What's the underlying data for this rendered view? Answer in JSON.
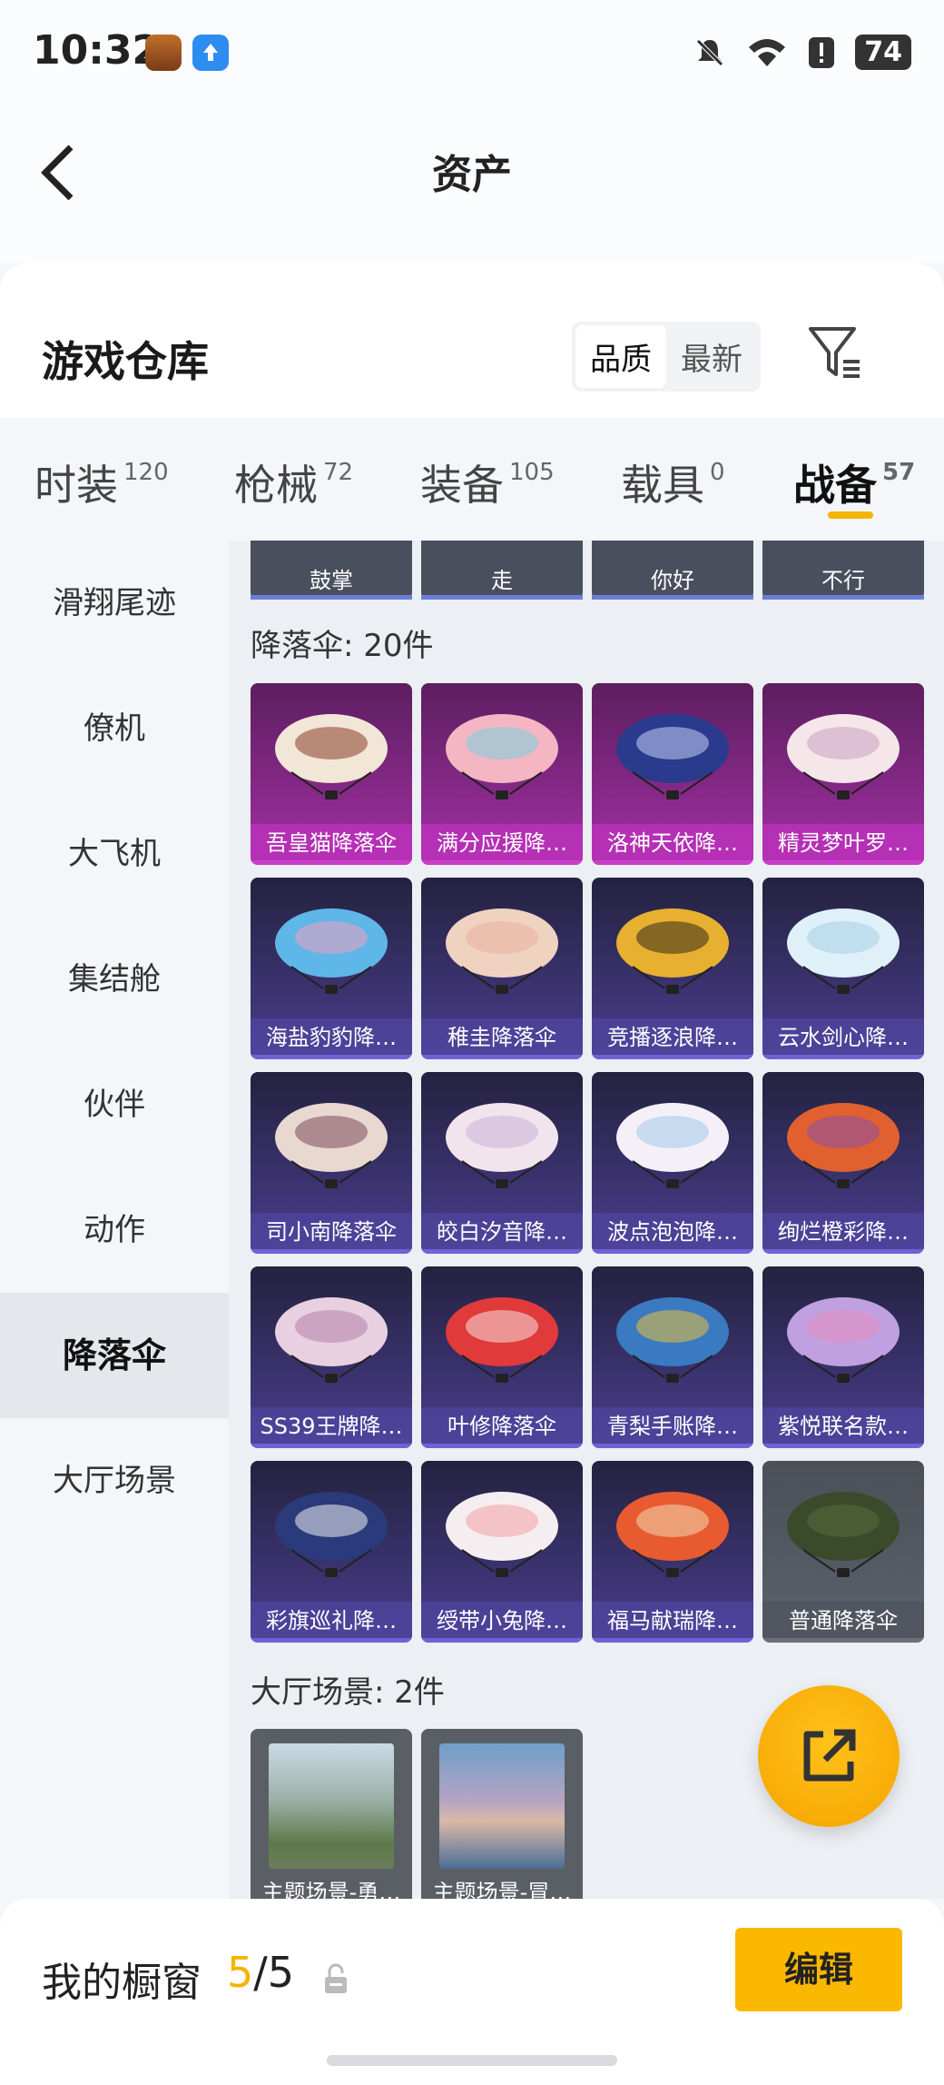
{
  "status_bar": {
    "time": "10:32",
    "battery": "74"
  },
  "nav": {
    "title": "资产"
  },
  "header": {
    "title": "游戏仓库",
    "sort_options": [
      "品质",
      "最新"
    ]
  },
  "tabs": [
    {
      "label": "时装",
      "count": "120"
    },
    {
      "label": "枪械",
      "count": "72"
    },
    {
      "label": "装备",
      "count": "105"
    },
    {
      "label": "载具",
      "count": "0"
    },
    {
      "label": "战备",
      "count": "57"
    }
  ],
  "sidebar": [
    "滑翔尾迹",
    "僚机",
    "大飞机",
    "集结舱",
    "伙伴",
    "动作",
    "降落伞",
    "大厅场景"
  ],
  "actions_row": [
    "鼓掌",
    "走",
    "你好",
    "不行"
  ],
  "parachute_section": {
    "title": "降落伞: 20件"
  },
  "parachutes": [
    "吾皇猫降落伞",
    "满分应援降…",
    "洛神天依降…",
    "精灵梦叶罗…",
    "海盐豹豹降…",
    "稚圭降落伞",
    "竞播逐浪降…",
    "云水剑心降…",
    "司小南降落伞",
    "皎白汐音降…",
    "波点泡泡降…",
    "绚烂橙彩降…",
    "SS39王牌降…",
    "叶修降落伞",
    "青梨手账降…",
    "紫悦联名款…",
    "彩旗巡礼降…",
    "绶带小兔降…",
    "福马献瑞降…",
    "普通降落伞"
  ],
  "lobby_section": {
    "title": "大厅场景: 2件"
  },
  "lobby_scenes": [
    "主题场景-勇…",
    "主题场景-冒…"
  ],
  "bottom": {
    "title": "我的橱窗",
    "count_used": "5",
    "count_sep": "/5",
    "edit_label": "编辑"
  },
  "colors": {
    "accent": "#f5b400",
    "purple_card": "#a230a4",
    "blue_card": "#4b3d8e"
  }
}
